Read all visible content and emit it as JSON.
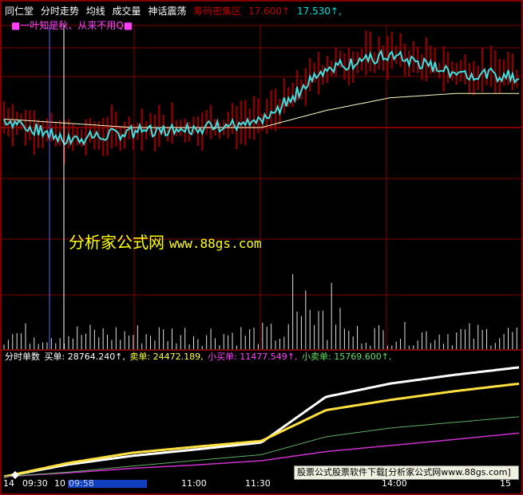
{
  "header": {
    "stock": "同仁堂",
    "view": "分时走势",
    "avg": "均线",
    "volume": "成交量",
    "formula": "神话震荡",
    "chip_label": "筹码密集区",
    "value1": "17.600↑",
    "value2": "17.530↑,"
  },
  "legend": "■一叶知是秋、从来不用Q■",
  "watermark": {
    "text": "分析家公式网",
    "url": "www.88gs.com"
  },
  "sub": {
    "title": "分时单数",
    "buy": "买单: 28764.240↑,",
    "sell": "卖单: 24472.189,",
    "small_buy": "小买单: 11477.549↑,",
    "small_sell": "小卖单: 15769.600↑,"
  },
  "banner": "股票公式股票软件下载[分析家公式网www.88gs.com]",
  "time_axis": [
    "14",
    "09:30",
    "10",
    "09:58",
    "11:00",
    "11:30",
    "14:00",
    "15"
  ],
  "colors": {
    "background": "#000000",
    "grid": "#800000",
    "depth_bars": "#8b0000",
    "price_line": "#40e0e0",
    "avg_line": "#ffffc0",
    "buy_line": "#ffffff",
    "sell_line": "#ffe040",
    "small_buy_line": "#d030d0",
    "small_sell_line": "#60b060"
  },
  "chart_data": [
    {
      "type": "line",
      "x": [
        "09:30",
        "10:00",
        "10:30",
        "11:00",
        "11:30",
        "13:30",
        "14:00",
        "14:30",
        "15:00"
      ],
      "series": [
        {
          "values": [
            17.5,
            17.45,
            17.47,
            17.48,
            17.49,
            17.62,
            17.65,
            17.61,
            17.6
          ]
        },
        {
          "values": [
            17.5,
            17.49,
            17.48,
            17.48,
            17.48,
            17.52,
            17.55,
            17.56,
            17.56
          ]
        }
      ],
      "ylim": [
        17.36,
        17.72
      ]
    },
    {
      "type": "line",
      "x": [
        "09:30",
        "10:00",
        "10:30",
        "11:00",
        "11:30",
        "13:30",
        "14:00",
        "14:30",
        "15:00"
      ],
      "series": [
        {
          "name": "买单",
          "values": [
            0,
            3200,
            5500,
            7200,
            9000,
            21000,
            24500,
            26800,
            28764.24
          ]
        },
        {
          "name": "卖单",
          "values": [
            0,
            3600,
            6300,
            7900,
            9400,
            17500,
            20200,
            22500,
            24472.189
          ]
        },
        {
          "name": "小买单",
          "values": [
            0,
            1000,
            2200,
            3100,
            4200,
            6600,
            8200,
            9800,
            11477.549
          ]
        },
        {
          "name": "小卖单",
          "values": [
            0,
            1200,
            2800,
            4300,
            5800,
            10500,
            12800,
            14300,
            15769.6
          ]
        }
      ],
      "ylim": [
        0,
        30000
      ]
    }
  ]
}
